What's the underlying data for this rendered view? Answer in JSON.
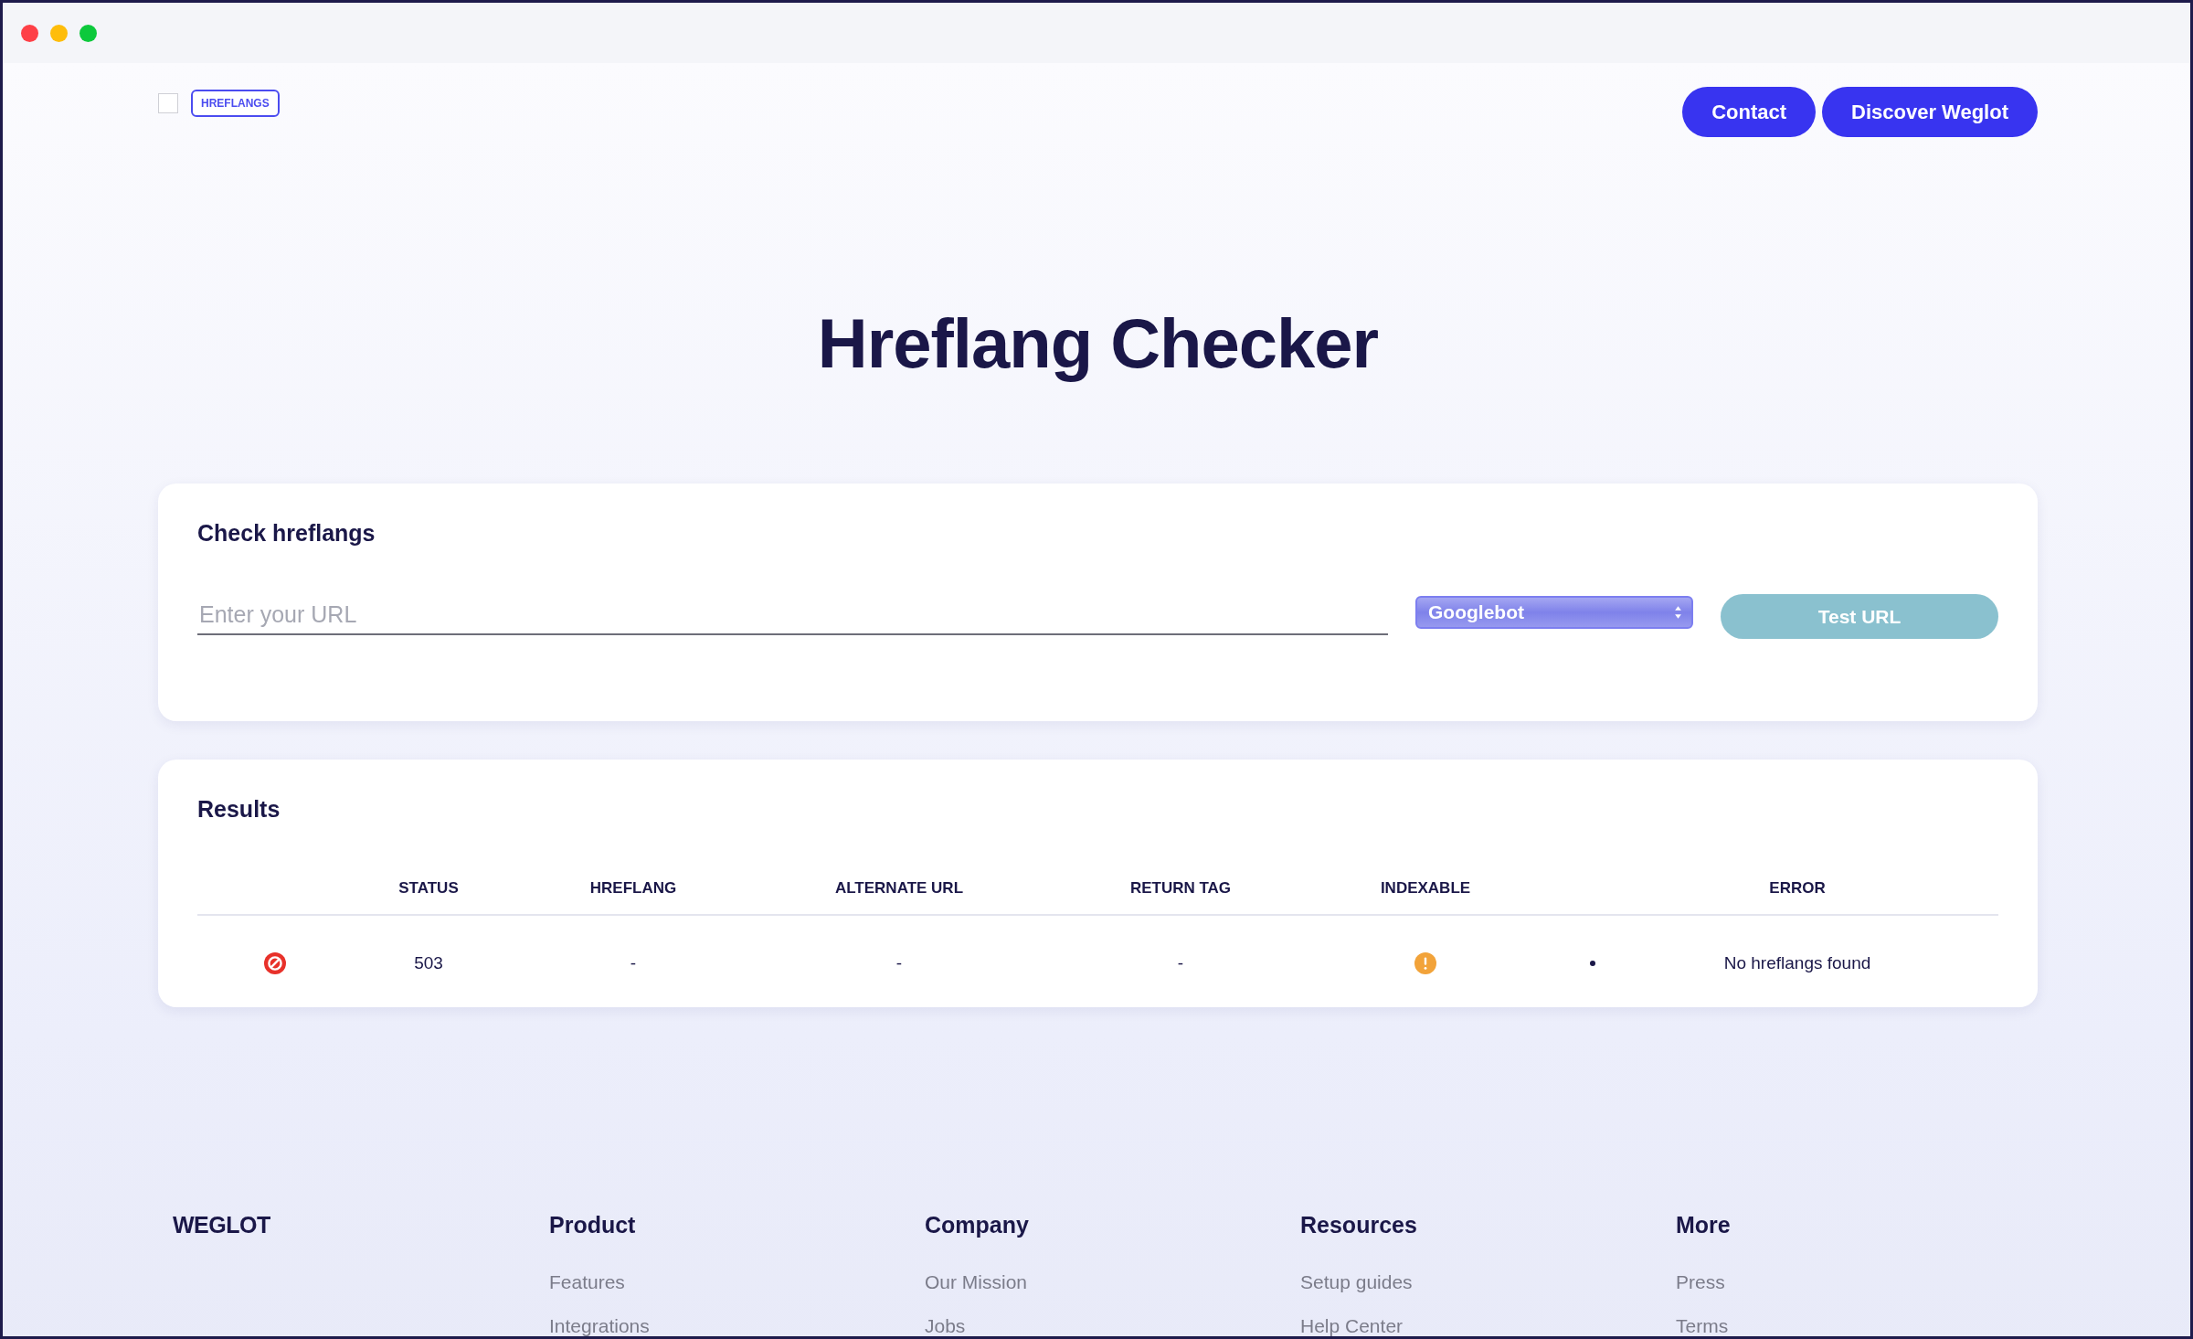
{
  "header": {
    "checkbox": {
      "checked": false
    },
    "badge": "HREFLANGS",
    "buttons": [
      "Contact",
      "Discover Weglot"
    ]
  },
  "title": "Hreflang Checker",
  "check_card": {
    "heading": "Check hreflangs",
    "url_field": {
      "placeholder": "Enter your URL"
    },
    "bot_select": {
      "value": "Googlebot"
    },
    "submit": "Test URL"
  },
  "results_card": {
    "heading": "Results",
    "table": {
      "columns": [
        "",
        "STATUS",
        "HREFLANG",
        "ALTERNATE URL",
        "RETURN TAG",
        "INDEXABLE",
        "",
        "ERROR"
      ],
      "rows": [
        {
          "cells": [
            {
              "kind": "error-icon"
            },
            {
              "kind": "text",
              "text": "503"
            },
            {
              "kind": "text",
              "text": "-"
            },
            {
              "kind": "text",
              "text": "-"
            },
            {
              "kind": "text",
              "text": "-"
            },
            {
              "kind": "warning-icon"
            },
            {
              "kind": "bullet"
            },
            {
              "kind": "text",
              "text": "No hreflangs found"
            }
          ]
        }
      ]
    }
  },
  "footer": {
    "logo": "WEGLOT",
    "columns": [
      {
        "heading": "Product",
        "links": [
          "Features",
          "Integrations"
        ]
      },
      {
        "heading": "Company",
        "links": [
          "Our Mission",
          "Jobs"
        ]
      },
      {
        "heading": "Resources",
        "links": [
          "Setup guides",
          "Help Center"
        ]
      },
      {
        "heading": "More",
        "links": [
          "Press",
          "Terms"
        ]
      }
    ]
  }
}
